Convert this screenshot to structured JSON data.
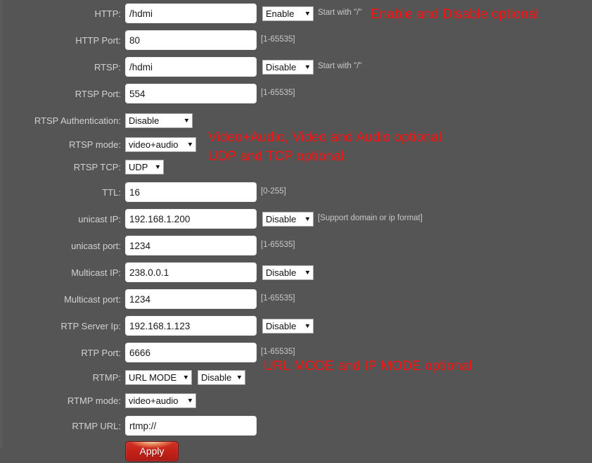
{
  "colors": {
    "background": "#555555",
    "label_text": "#d2d2d2",
    "hint_text": "#c9c9c9",
    "annotation_red": "#ff1111",
    "input_background": "#ffffff",
    "apply_button": "#c42219"
  },
  "form": {
    "rows": [
      {
        "label": "HTTP:",
        "input_value": "/hdmi",
        "select_value": "Enable",
        "hint": "Start with \"/\""
      },
      {
        "label": "HTTP Port:",
        "input_value": "80",
        "hint": "[1-65535]"
      },
      {
        "label": "RTSP:",
        "input_value": "/hdmi",
        "select_value": "Disable",
        "hint": "Start with \"/\""
      },
      {
        "label": "RTSP Port:",
        "input_value": "554",
        "hint": "[1-65535]"
      },
      {
        "label": "RTSP Authentication:",
        "select_value": "Disable"
      },
      {
        "label": "RTSP mode:",
        "select_value": "video+audio"
      },
      {
        "label": "RTSP TCP:",
        "select_value": "UDP"
      },
      {
        "label": "TTL:",
        "input_value": "16",
        "hint": "[0-255]"
      },
      {
        "label": "unicast IP:",
        "input_value": "192.168.1.200",
        "select_value": "Disable",
        "hint": "[Support domain or ip format]"
      },
      {
        "label": "unicast port:",
        "input_value": "1234",
        "hint": "[1-65535]"
      },
      {
        "label": "Multicast IP:",
        "input_value": "238.0.0.1",
        "select_value": "Disable"
      },
      {
        "label": "Multicast port:",
        "input_value": "1234",
        "hint": "[1-65535]"
      },
      {
        "label": "RTP Server Ip:",
        "input_value": "192.168.1.123",
        "select_value": "Disable"
      },
      {
        "label": "RTP Port:",
        "input_value": "6666",
        "hint": "[1-65535]"
      },
      {
        "label": "RTMP:",
        "select_value": "URL MODE",
        "select2_value": "Disable"
      },
      {
        "label": "RTMP mode:",
        "select_value": "video+audio"
      },
      {
        "label": "RTMP URL:",
        "input_value": "rtmp://"
      }
    ],
    "apply_label": "Apply"
  },
  "annotations": {
    "enable_disable": "Enable and Disable optional",
    "rtsp_mode": "Video+Audio, Video and Audio optional",
    "rtsp_tcp": "UDP and TCP optional",
    "rtmp_mode": "URL MODE and IP MODE optional"
  },
  "icons": {
    "dropdown_arrow": "chevron-down-icon"
  }
}
